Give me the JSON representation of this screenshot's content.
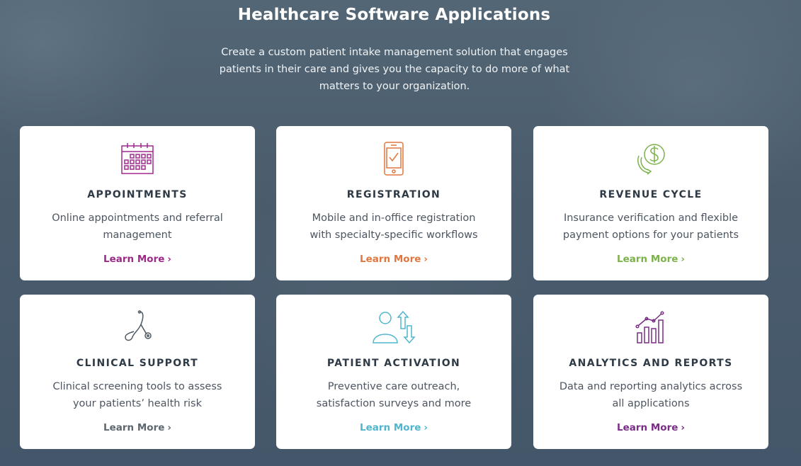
{
  "header": {
    "title": "Healthcare Software Applications",
    "subtitle": "Create a custom patient intake management solution that engages patients in their care and gives you the capacity to do more of what matters to your organization."
  },
  "cards": [
    {
      "title": "APPOINTMENTS",
      "description": "Online appointments and referral management",
      "link_label": "Learn More",
      "icon": "calendar-icon",
      "color": "#9b2a87"
    },
    {
      "title": "REGISTRATION",
      "description": "Mobile and in-office registration with specialty-specific workflows",
      "link_label": "Learn More",
      "icon": "mobile-checkmark-icon",
      "color": "#e0773f"
    },
    {
      "title": "REVENUE CYCLE",
      "description": "Insurance verification and flexible payment options for your patients",
      "link_label": "Learn More",
      "icon": "dollar-cycle-icon",
      "color": "#7cb24a"
    },
    {
      "title": "CLINICAL SUPPORT",
      "description": "Clinical screening tools to assess your patients’ health risk",
      "link_label": "Learn More",
      "icon": "stethoscope-icon",
      "color": "#5c6770"
    },
    {
      "title": "PATIENT ACTIVATION",
      "description": "Preventive care outreach, satisfaction surveys and more",
      "link_label": "Learn More",
      "icon": "patient-arrows-icon",
      "color": "#4fb6cd"
    },
    {
      "title": "ANALYTICS AND REPORTS",
      "description": "Data and reporting analytics across all applications",
      "link_label": "Learn More",
      "icon": "bar-chart-icon",
      "color": "#7a2d86"
    }
  ]
}
